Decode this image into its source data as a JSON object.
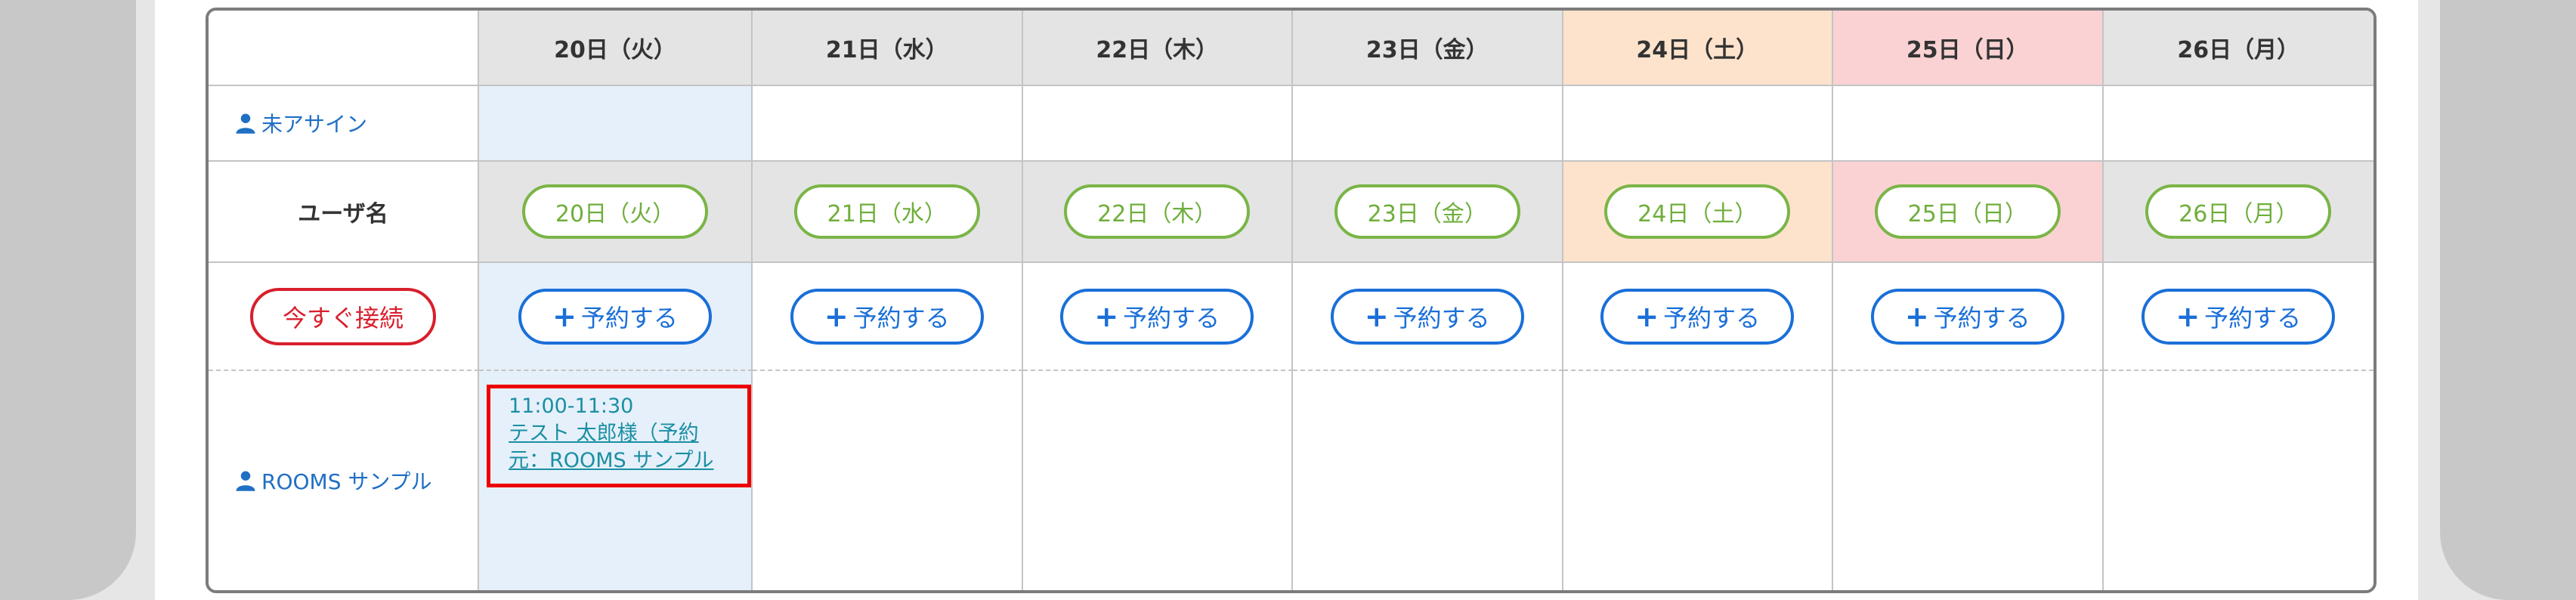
{
  "header": {
    "days": [
      {
        "label": "20日（火）",
        "kind": "weekday"
      },
      {
        "label": "21日（水）",
        "kind": "weekday"
      },
      {
        "label": "22日（木）",
        "kind": "weekday"
      },
      {
        "label": "23日（金）",
        "kind": "weekday"
      },
      {
        "label": "24日（土）",
        "kind": "sat"
      },
      {
        "label": "25日（日）",
        "kind": "sun"
      },
      {
        "label": "26日（月）",
        "kind": "weekday"
      }
    ]
  },
  "unassigned": {
    "label": "未アサイン",
    "icon": "user-icon"
  },
  "username_row": {
    "label": "ユーザ名",
    "day_buttons": [
      "20日（火）",
      "21日（水）",
      "22日（木）",
      "23日（金）",
      "24日（土）",
      "25日（日）",
      "26日（月）"
    ]
  },
  "actions": {
    "connect_now_label": "今すぐ接続",
    "reserve_label": "予約する",
    "reserve_icon": "plus-icon"
  },
  "user": {
    "name": "ROOMS サンプル",
    "icon": "user-icon"
  },
  "booking": {
    "time": "11:00-11:30",
    "title": "テスト 太郎様（予約\n元：ROOMS サンプル"
  },
  "colors": {
    "header_bg": "#e4e4e4",
    "saturday_bg": "#fde3cc",
    "sunday_bg": "#fad2d4",
    "today_bg": "#e6f0fa",
    "link_blue": "#1f6fc4",
    "reserve_blue": "#1a6fd8",
    "day_green": "#7ab547",
    "connect_red": "#d81f2c",
    "highlight_red": "#ee0000",
    "booking_teal": "#1a8fa3"
  }
}
